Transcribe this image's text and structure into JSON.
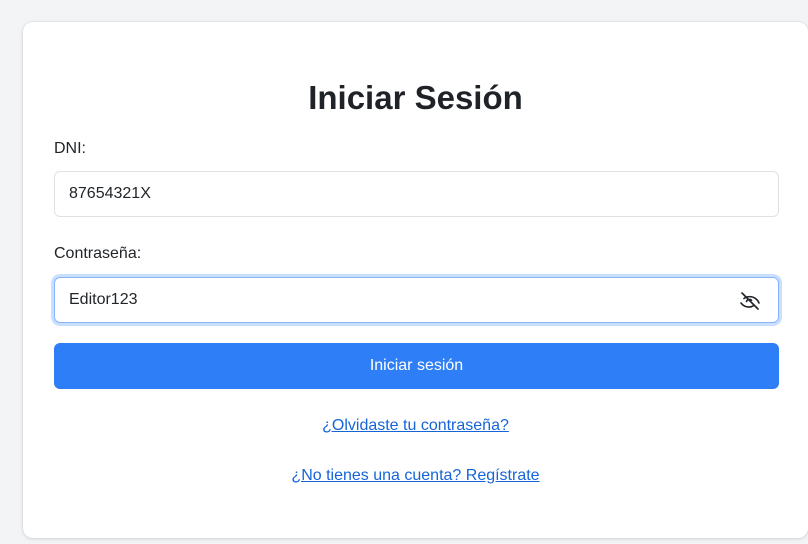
{
  "login": {
    "title": "Iniciar Sesión",
    "dni_label": "DNI:",
    "dni_value": "87654321X",
    "password_label": "Contraseña:",
    "password_value": "Editor123",
    "toggle_icon": "eye-slash-icon",
    "submit_label": "Iniciar sesión",
    "forgot_link": "¿Olvidaste tu contraseña?",
    "register_link": "¿No tienes una cuenta? Regístrate"
  },
  "colors": {
    "primary": "#2d7ef7",
    "link": "#1565d8",
    "focus_border": "#86b7fe",
    "background": "#f3f4f6"
  }
}
